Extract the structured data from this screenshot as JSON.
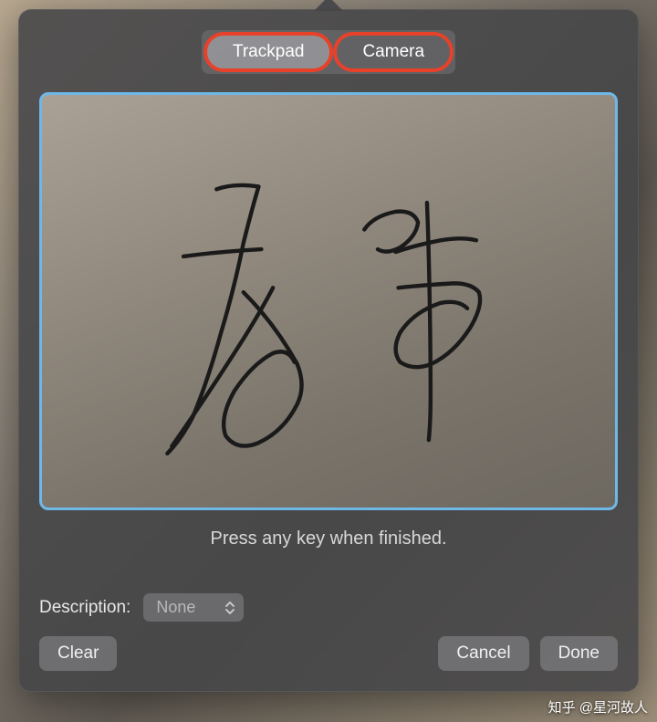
{
  "tabs": {
    "trackpad": "Trackpad",
    "camera": "Camera",
    "active": "trackpad"
  },
  "hint": "Press any key when finished.",
  "description": {
    "label": "Description:",
    "value": "None"
  },
  "buttons": {
    "clear": "Clear",
    "cancel": "Cancel",
    "done": "Done"
  },
  "watermark": "知乎 @星河故人"
}
